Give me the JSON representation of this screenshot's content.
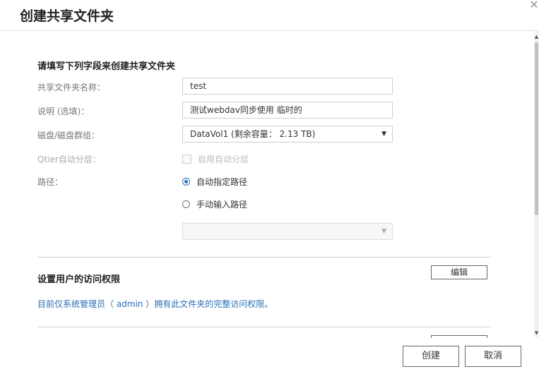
{
  "dialog": {
    "title": "创建共享文件夹",
    "close_symbol": "✕"
  },
  "form": {
    "section_title": "请填写下列字段来创建共享文件夹",
    "name": {
      "label": "共享文件夹名称：",
      "value": "test"
    },
    "description": {
      "label": "说明 (选填)：",
      "value": "测试webdav同步使用 临时的"
    },
    "disk": {
      "label": "磁盘/磁盘群组：",
      "value": "DataVol1 (剩余容量： 2.13 TB)"
    },
    "qtier": {
      "label": "Qtier自动分层：",
      "checkbox_label": "启用自动分层",
      "checked": false,
      "disabled": true
    },
    "path": {
      "label": "路径：",
      "options": [
        {
          "label": "自动指定路径",
          "checked": true
        },
        {
          "label": "手动输入路径",
          "checked": false
        }
      ],
      "select_value": ""
    }
  },
  "permissions": {
    "section_title": "设置用户的访问权限",
    "edit_label": "编辑",
    "info": "目前仅系统管理员（ admin ）拥有此文件夹的完整访问权限。"
  },
  "footer": {
    "create_label": "创建",
    "cancel_label": "取消"
  },
  "icons": {
    "close": "close-icon",
    "dropdown": "caret-down-icon",
    "scroll_up": "arrow-up-icon",
    "scroll_down": "arrow-down-icon"
  },
  "colors": {
    "accent": "#2a6fb5"
  }
}
